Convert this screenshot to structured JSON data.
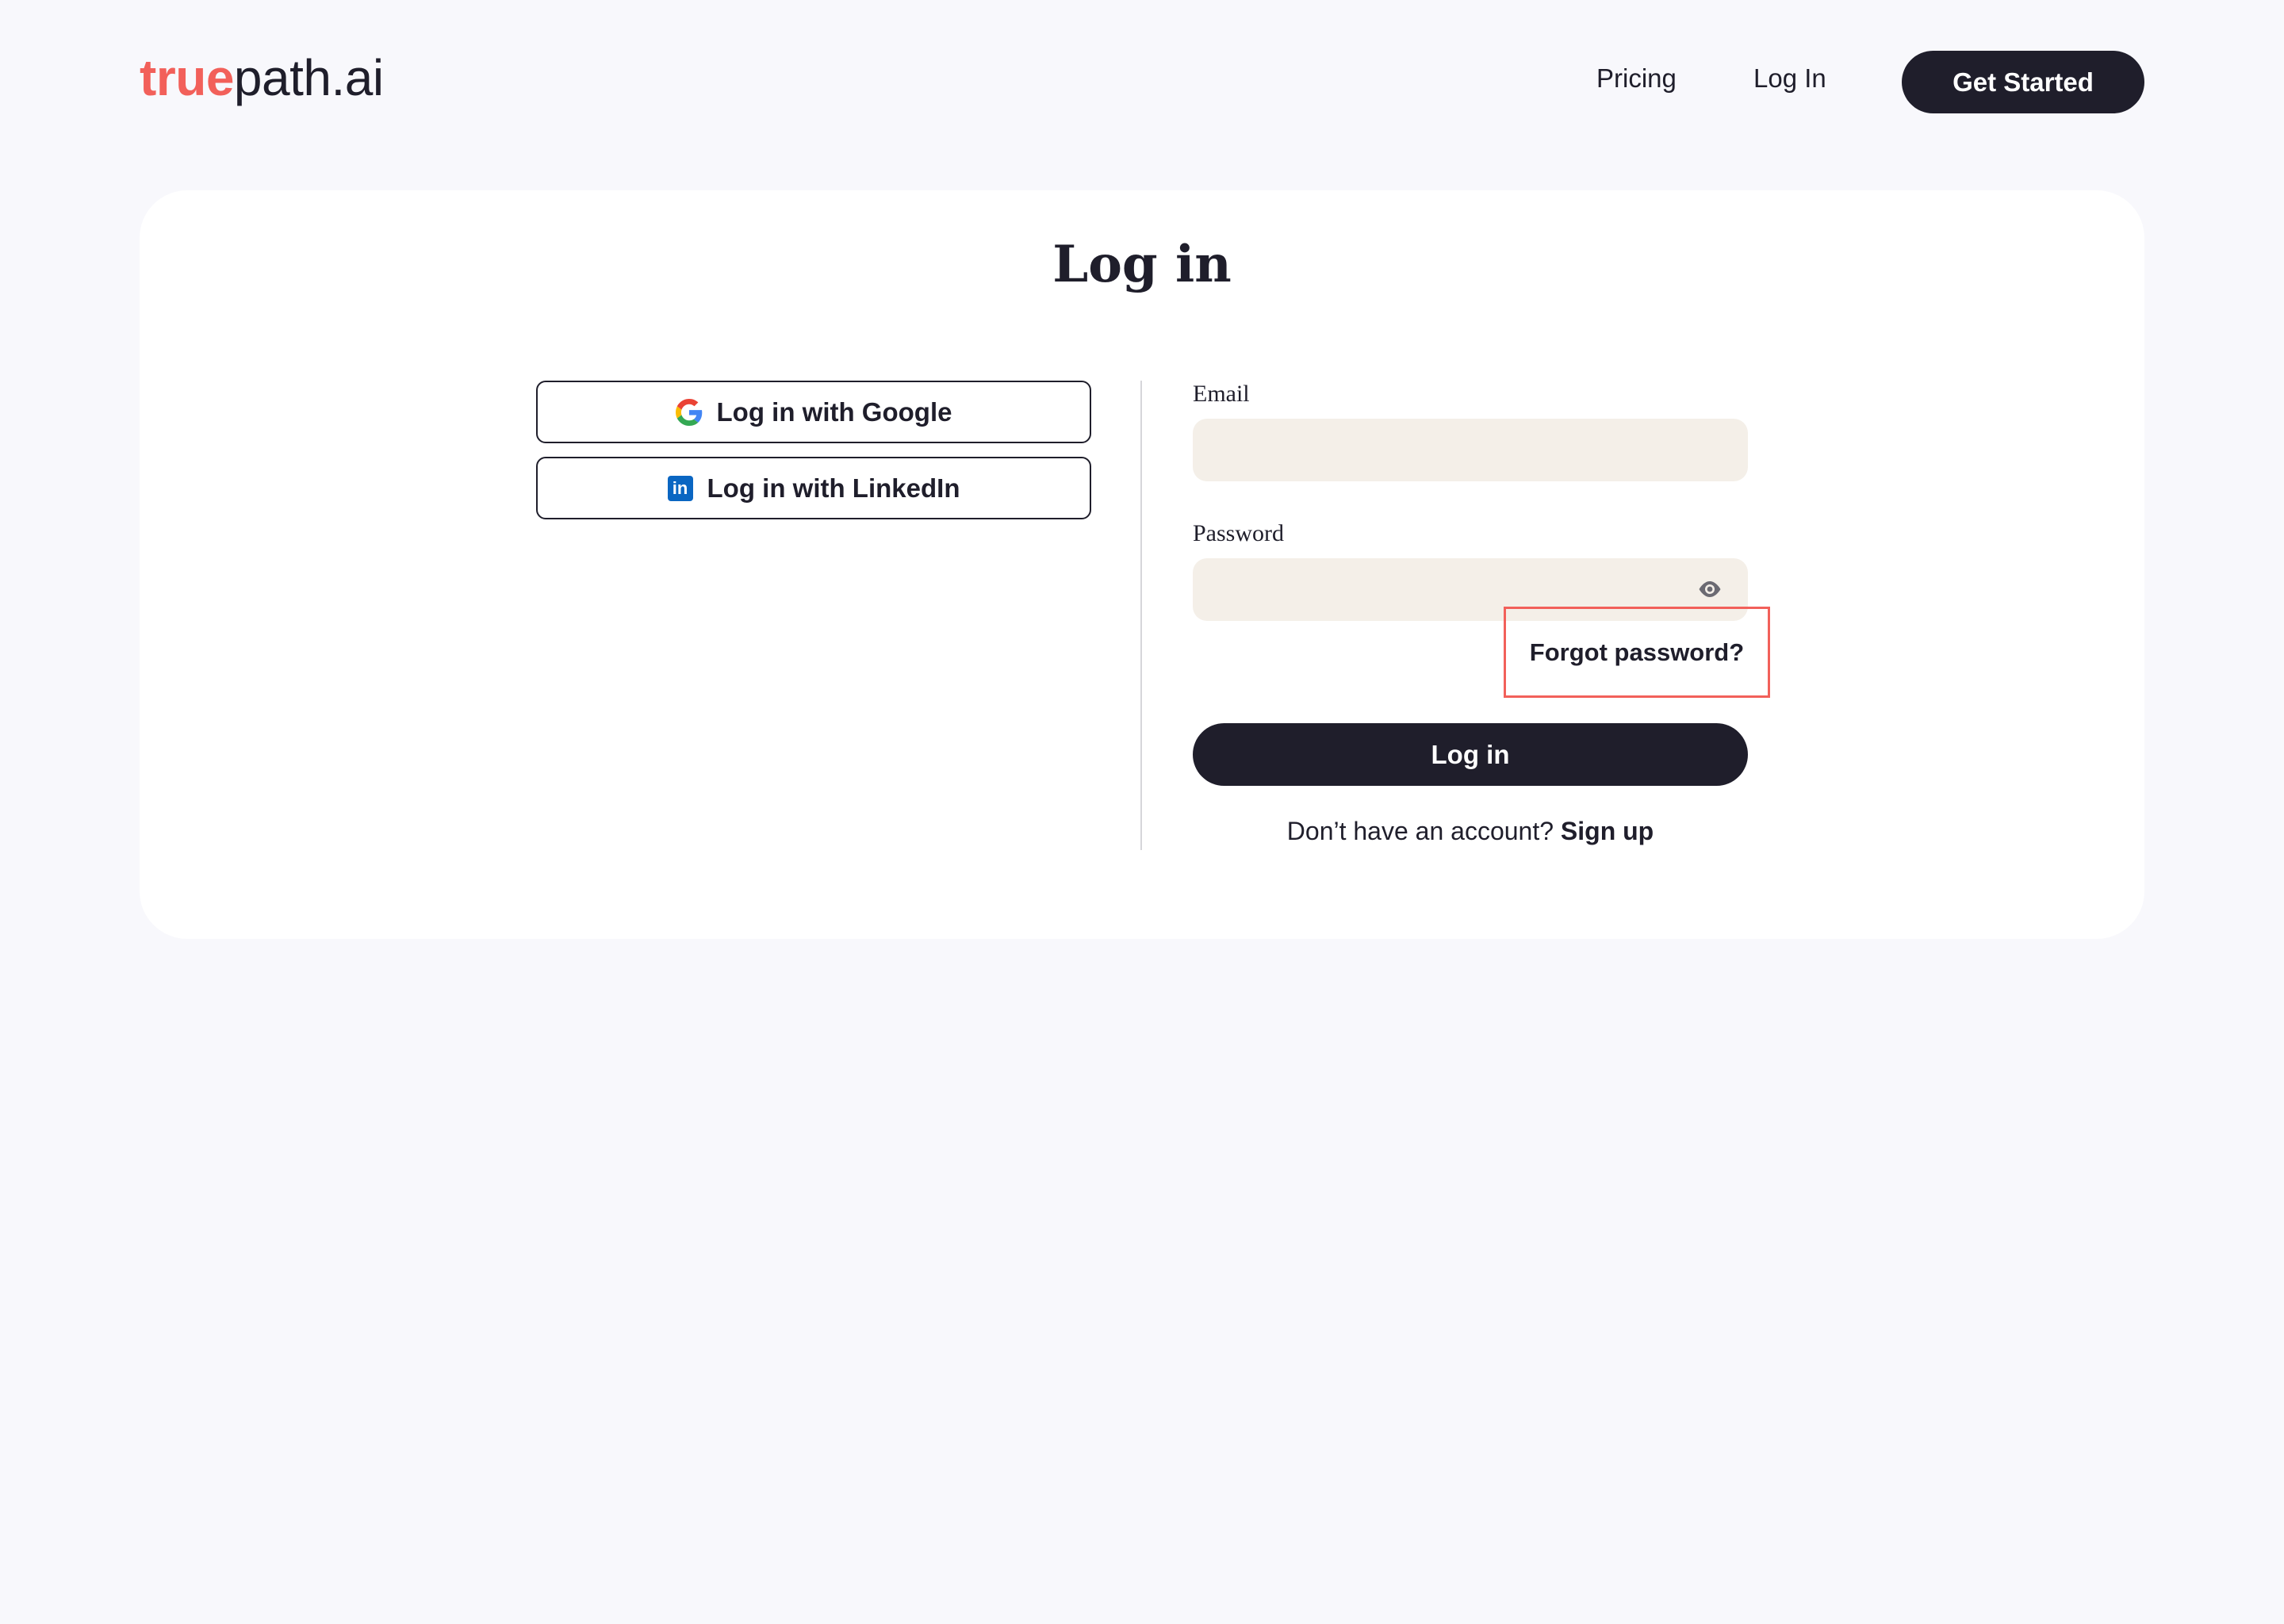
{
  "header": {
    "logo": {
      "brand_part": "true",
      "rest_part": "path.ai"
    },
    "nav": {
      "pricing": "Pricing",
      "login": "Log In"
    },
    "cta": "Get Started"
  },
  "colors": {
    "brand": "#f2605a",
    "dark": "#1f1e2b",
    "page_bg": "#f8f8fc",
    "input_bg": "#f4efe8",
    "highlight_box": "#f2605a",
    "linkedin": "#0a66c2"
  },
  "card": {
    "title": "Log in",
    "social": {
      "google": {
        "label": "Log in with Google",
        "icon": "google-icon"
      },
      "linkedin": {
        "label": "Log in with LinkedIn",
        "icon": "linkedin-icon",
        "icon_text": "in"
      }
    },
    "form": {
      "email": {
        "label": "Email",
        "value": "",
        "placeholder": ""
      },
      "password": {
        "label": "Password",
        "value": "",
        "placeholder": "",
        "toggle_icon": "eye-icon"
      },
      "forgot": "Forgot password?",
      "submit": "Log in",
      "signup_prompt": "Don’t have an account?",
      "signup_link": "Sign up"
    }
  }
}
